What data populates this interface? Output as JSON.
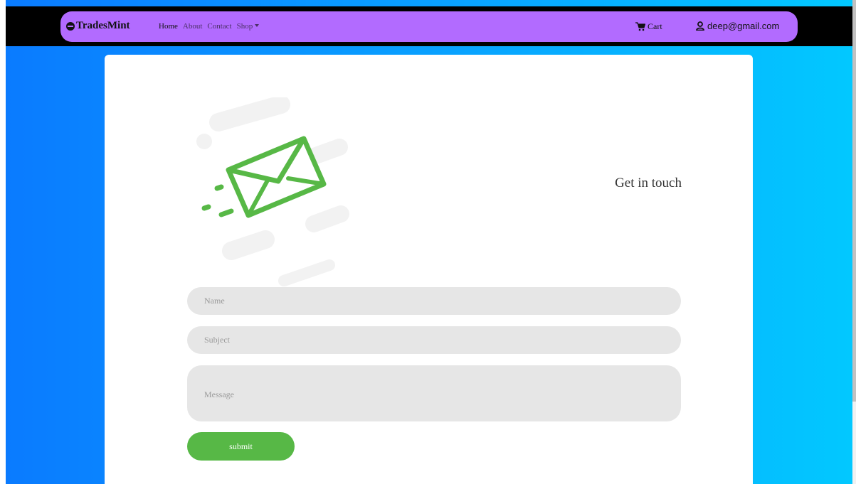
{
  "navbar": {
    "brand": "TradesMint",
    "links": [
      "Home",
      "About",
      "Contact",
      "Shop"
    ],
    "cart_label": "Cart",
    "user_email": "deep@gmail.com"
  },
  "contact": {
    "heading": "Get in touch",
    "name_placeholder": "Name",
    "subject_placeholder": "Subject",
    "message_placeholder": "Message",
    "submit_label": "submit"
  },
  "colors": {
    "navbar_bg": "#b26bff",
    "accent_green": "#57b846",
    "field_bg": "#e6e6e6",
    "page_gradient_start": "#0a7bff",
    "page_gradient_end": "#02c8ff"
  },
  "icons": [
    "brand-logo-icon",
    "shop-caret-icon",
    "cart-icon",
    "user-icon",
    "envelope-icon"
  ]
}
